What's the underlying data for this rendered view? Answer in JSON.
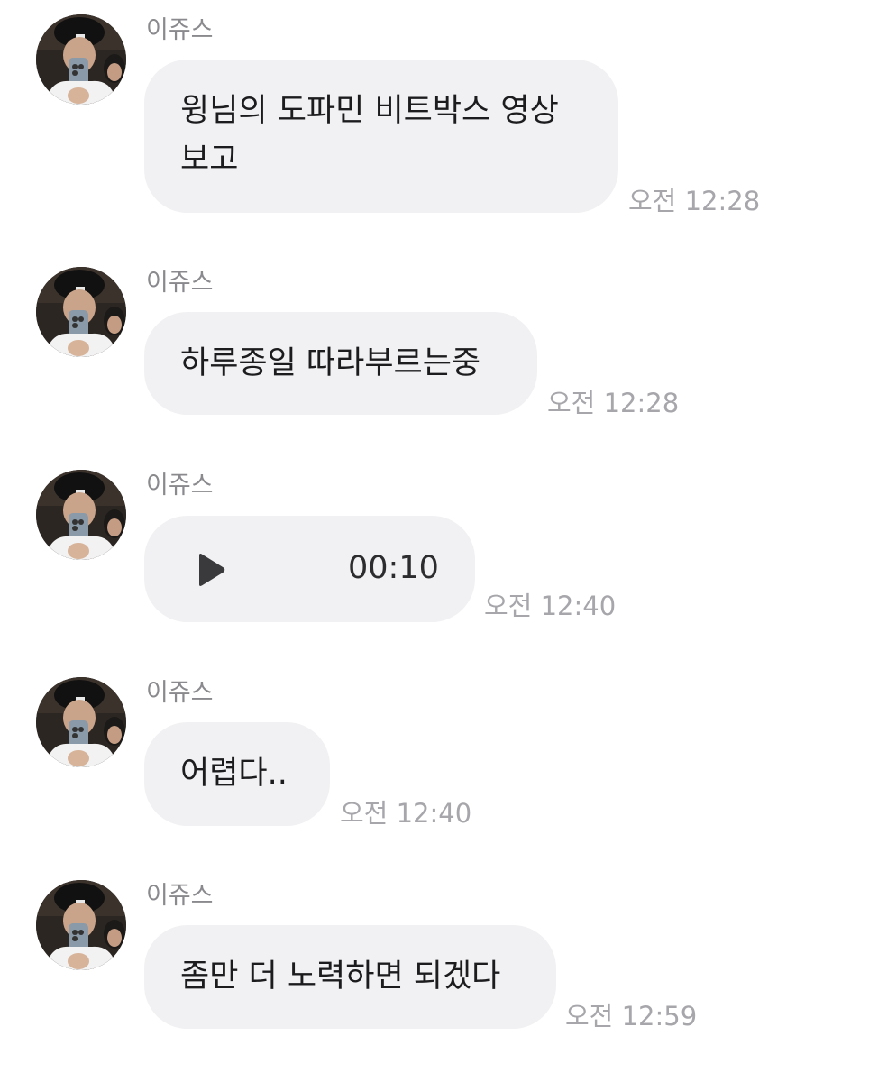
{
  "chat": {
    "messages": [
      {
        "sender": "이쥬스",
        "avatar_icon": "profile-photo-icon",
        "lines": [
          "윙님의 도파민 비트박스 영상",
          "보고"
        ],
        "time": "오전 12:28"
      },
      {
        "sender": "이쥬스",
        "avatar_icon": "profile-photo-icon",
        "text": "하루종일 따라부르는중",
        "time": "오전 12:28"
      },
      {
        "sender": "이쥬스",
        "avatar_icon": "profile-photo-icon",
        "voice": {
          "play_icon": "play-icon",
          "duration": "00:10"
        },
        "time": "오전 12:40"
      },
      {
        "sender": "이쥬스",
        "avatar_icon": "profile-photo-icon",
        "text": "어렵다..",
        "time": "오전 12:40"
      },
      {
        "sender": "이쥬스",
        "avatar_icon": "profile-photo-icon",
        "text": "좀만 더 노력하면 되겠다",
        "time": "오전 12:59"
      }
    ]
  },
  "colors": {
    "bubble": "#f1f1f3",
    "sender": "#8a8a8e",
    "time": "#a6a6ab",
    "text": "#1c1c1e"
  }
}
